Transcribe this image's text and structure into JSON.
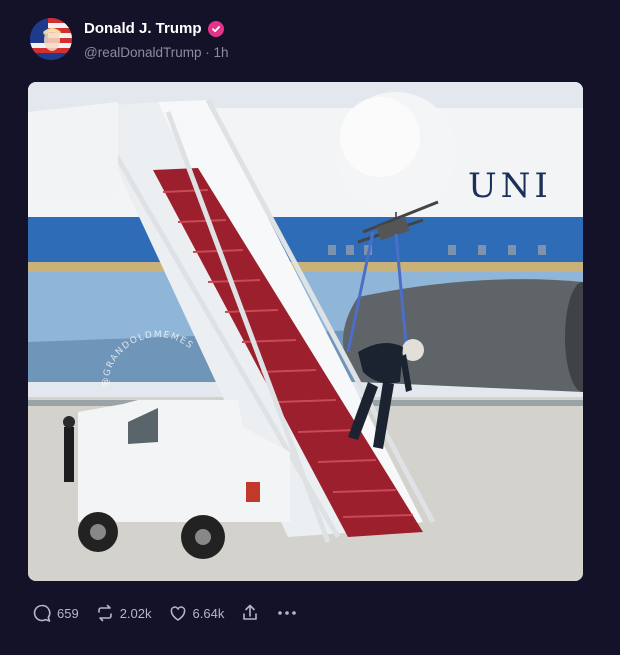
{
  "post": {
    "author_name": "Donald J. Trump",
    "handle_time": "@realDonaldTrump · 1h",
    "avatar_icon": "flag-portrait-avatar",
    "verified_color": "#e5338b",
    "image_watermark": "@GRANDOLDMEMES"
  },
  "actions": {
    "replies": "659",
    "reposts": "2.02k",
    "likes": "6.64k"
  }
}
